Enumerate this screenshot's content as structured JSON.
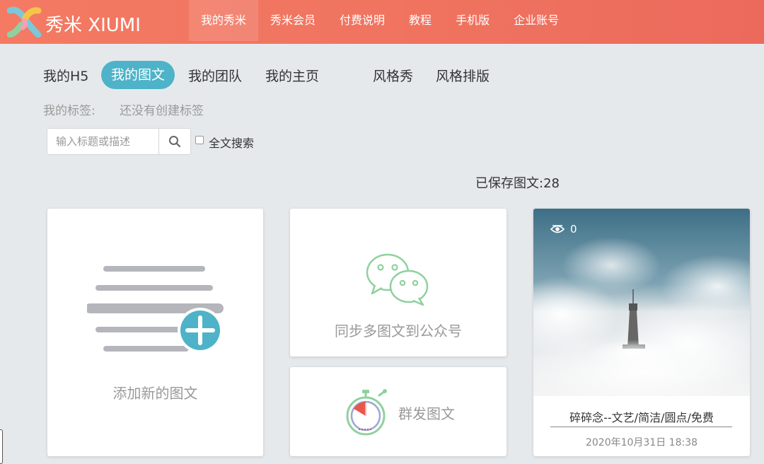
{
  "brand": {
    "name": "秀米 XIUMI"
  },
  "nav": {
    "items": [
      {
        "label": "我的秀米"
      },
      {
        "label": "秀米会员"
      },
      {
        "label": "付费说明"
      },
      {
        "label": "教程"
      },
      {
        "label": "手机版"
      },
      {
        "label": "企业账号"
      }
    ],
    "active_index": 0
  },
  "tabs": [
    {
      "label": "我的H5"
    },
    {
      "label": "我的图文"
    },
    {
      "label": "我的团队"
    },
    {
      "label": "我的主页"
    },
    {
      "label": "风格秀"
    },
    {
      "label": "风格排版"
    }
  ],
  "tags": {
    "label": "我的标签:",
    "empty_text": "还没有创建标签"
  },
  "search": {
    "placeholder": "输入标题或描述",
    "value": "",
    "fulltext_label": "全文搜索",
    "fulltext_checked": false
  },
  "saved": {
    "text": "已保存图文:28"
  },
  "cards": {
    "add": {
      "label": "添加新的图文",
      "icon": "add-document-icon"
    },
    "sync": {
      "label": "同步多图文到公众号",
      "icon": "wechat-icon"
    },
    "mass": {
      "label": "群发图文",
      "icon": "timer-icon"
    }
  },
  "articles": [
    {
      "views": "0",
      "title": "碎碎念--文艺/简洁/圆点/免费",
      "date": "2020年10月31日 18:38"
    }
  ],
  "colors": {
    "header": "#f07460",
    "accent": "#4eb3c8",
    "wechat": "#8fd19e"
  }
}
